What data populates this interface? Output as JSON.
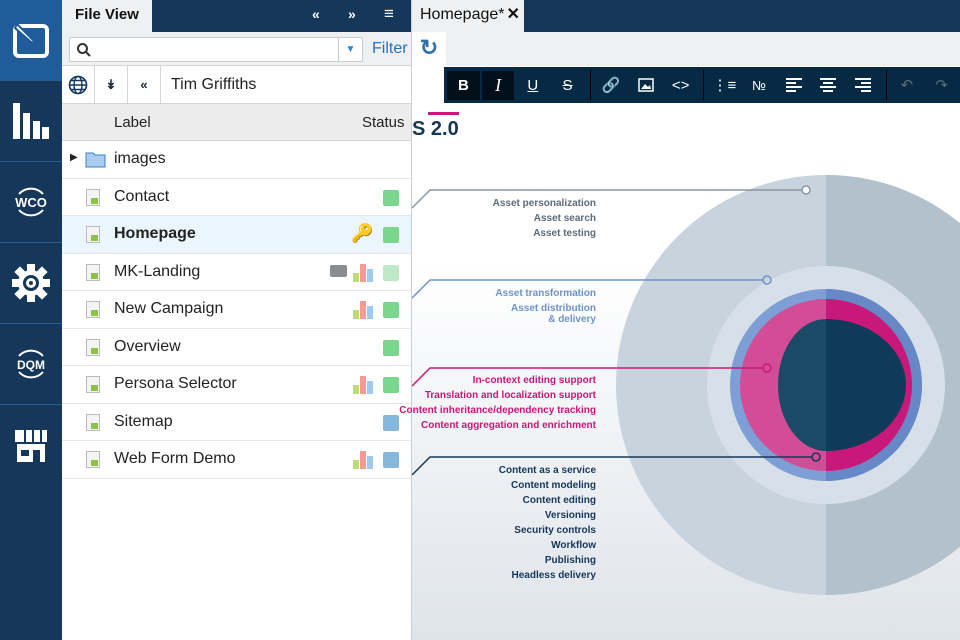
{
  "rail": [
    {
      "icon": "edit-icon"
    },
    {
      "icon": "analytics-icon"
    },
    {
      "icon": "wco-icon",
      "label": "WCO"
    },
    {
      "icon": "gear-icon"
    },
    {
      "icon": "dqm-icon",
      "label": "DQM"
    },
    {
      "icon": "marketplace-icon"
    }
  ],
  "panel": {
    "tab": "File View",
    "filter_label": "Filter",
    "search_value": "",
    "user": "Tim Griffiths",
    "col_label": "Label",
    "col_status": "Status",
    "rows": [
      {
        "label": "images",
        "type": "folder"
      },
      {
        "label": "Contact",
        "status": "#79d68c"
      },
      {
        "label": "Homepage",
        "status": "#79d68c",
        "lock": true,
        "selected": true
      },
      {
        "label": "MK-Landing",
        "status": "#bfe9c8",
        "comment": true,
        "analytics": true
      },
      {
        "label": "New Campaign",
        "status": "#79d68c",
        "analytics": true
      },
      {
        "label": "Overview",
        "status": "#79d68c"
      },
      {
        "label": "Persona Selector",
        "status": "#79d68c",
        "analytics": true
      },
      {
        "label": "Sitemap",
        "status": "#86b8dc"
      },
      {
        "label": "Web Form Demo",
        "status": "#86b8dc",
        "analytics": true
      }
    ]
  },
  "editor": {
    "tab": "Homepage*",
    "heading_fragment": "s 2.0",
    "toolbar": [
      "bold",
      "italic",
      "underline",
      "strikethrough",
      "link",
      "image",
      "code",
      "bullet-list",
      "numbered-list",
      "align-left",
      "align-center",
      "align-right",
      "undo",
      "redo"
    ],
    "groups": [
      {
        "color": "#5d6b78",
        "items": [
          "Asset personalization",
          "Asset search",
          "Asset testing"
        ]
      },
      {
        "color": "#6f93c9",
        "items": [
          "Asset transformation",
          "Asset distribution",
          "& delivery"
        ]
      },
      {
        "color": "#c8187a",
        "items": [
          "In-context editing support",
          "Translation and localization support",
          "Content inheritance/dependency tracking",
          "Content aggregation and enrichment"
        ]
      },
      {
        "color": "#16365a",
        "items": [
          "Content as a service",
          "Content modeling",
          "Content editing",
          "Versioning",
          "Security controls",
          "Workflow",
          "Publishing",
          "Headless delivery"
        ]
      }
    ]
  }
}
